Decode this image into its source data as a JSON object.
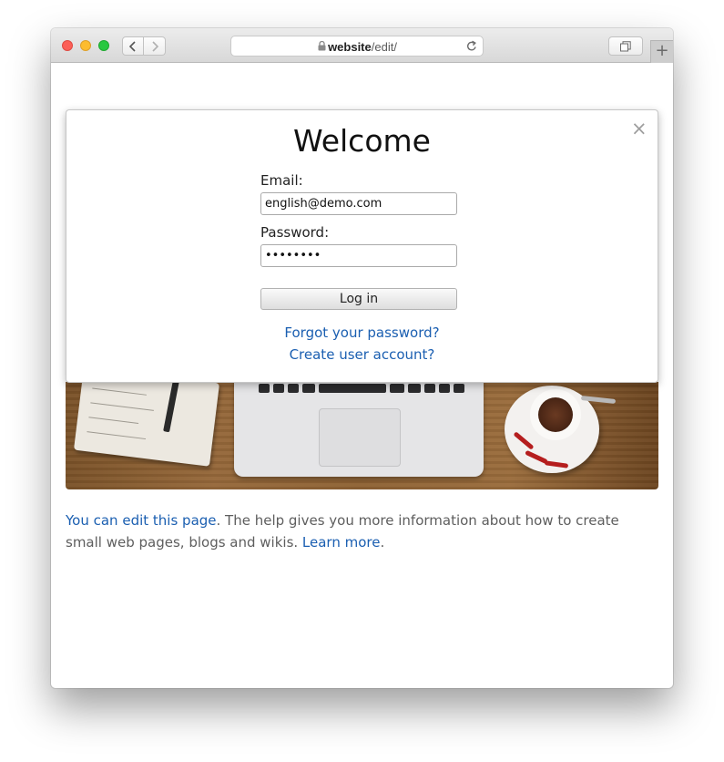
{
  "browser": {
    "address": {
      "host": "website",
      "path": "/edit/"
    },
    "buttons": {
      "new_tab_label": "+"
    }
  },
  "modal": {
    "title": "Welcome",
    "close_label": "×",
    "email_label": "Email:",
    "email_value": "english@demo.com",
    "password_label": "Password:",
    "password_value": "••••••••",
    "login_label": "Log in",
    "forgot_label": "Forgot your password?",
    "create_label": "Create user account?"
  },
  "page": {
    "edit_link": "You can edit this page",
    "text_1": ". The help gives you more information about how to create small web pages, blogs and wikis. ",
    "learn_more": "Learn more",
    "text_2": "."
  },
  "icons": [
    "close-icon",
    "back-icon",
    "forward-icon",
    "lock-icon",
    "reload-icon",
    "tabs-icon",
    "plus-icon"
  ],
  "colors": {
    "link": "#1b5fb1",
    "text": "#5e5e5e",
    "close": "#fc5f57",
    "minimize": "#fdbc2e",
    "zoom": "#28c840"
  }
}
